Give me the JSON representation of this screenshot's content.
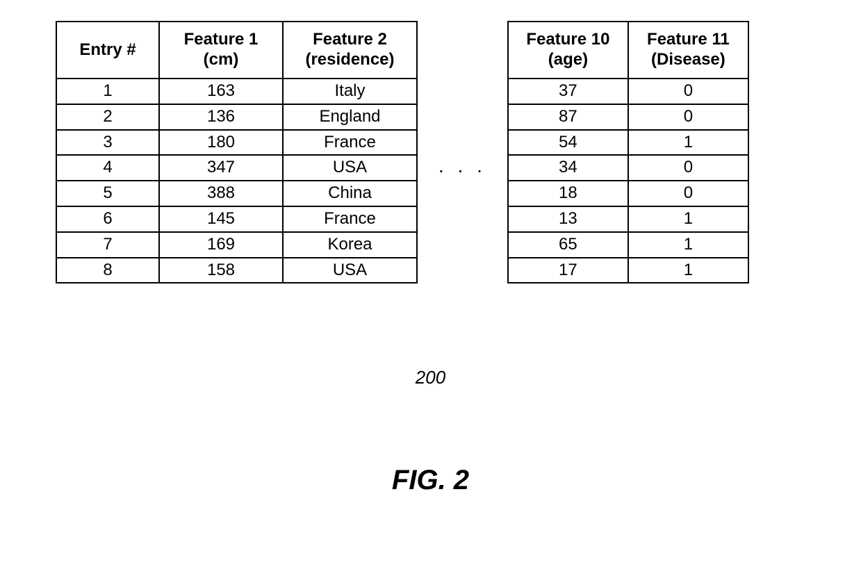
{
  "tableLeft": {
    "headers": {
      "entry": "Entry #",
      "feature1": "Feature 1 (cm)",
      "feature2": "Feature 2 (residence)"
    },
    "rows": [
      {
        "entry": "1",
        "f1": "163",
        "f2": "Italy"
      },
      {
        "entry": "2",
        "f1": "136",
        "f2": "England"
      },
      {
        "entry": "3",
        "f1": "180",
        "f2": "France"
      },
      {
        "entry": "4",
        "f1": "347",
        "f2": "USA"
      },
      {
        "entry": "5",
        "f1": "388",
        "f2": "China"
      },
      {
        "entry": "6",
        "f1": "145",
        "f2": "France"
      },
      {
        "entry": "7",
        "f1": "169",
        "f2": "Korea"
      },
      {
        "entry": "8",
        "f1": "158",
        "f2": "USA"
      }
    ]
  },
  "ellipsis": ". . .",
  "tableRight": {
    "headers": {
      "feature10": "Feature 10 (age)",
      "feature11": "Feature 11 (Disease)"
    },
    "rows": [
      {
        "f10": "37",
        "f11": "0"
      },
      {
        "f10": "87",
        "f11": "0"
      },
      {
        "f10": "54",
        "f11": "1"
      },
      {
        "f10": "34",
        "f11": "0"
      },
      {
        "f10": "18",
        "f11": "0"
      },
      {
        "f10": "13",
        "f11": "1"
      },
      {
        "f10": "65",
        "f11": "1"
      },
      {
        "f10": "17",
        "f11": "1"
      }
    ]
  },
  "refNumber": "200",
  "figTitle": "FIG. 2"
}
